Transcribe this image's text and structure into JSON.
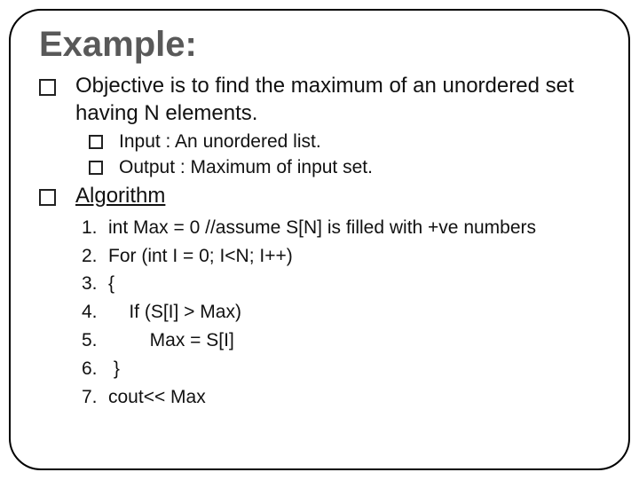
{
  "title": "Example:",
  "bullets": [
    {
      "text": "Objective is to find the maximum of an unordered set having N elements.",
      "sub": [
        {
          "text": "Input : An unordered list."
        },
        {
          "text": "Output : Maximum of input set."
        }
      ]
    },
    {
      "text": "Algorithm",
      "underline": true,
      "steps": [
        {
          "n": "1.",
          "t": "int Max = 0 //assume S[N] is filled with +ve numbers"
        },
        {
          "n": "2.",
          "t": "For (int I = 0; I<N; I++)"
        },
        {
          "n": "3.",
          "t": "{"
        },
        {
          "n": "4.",
          "t": "    If (S[I] > Max)"
        },
        {
          "n": "5.",
          "t": "        Max = S[I]"
        },
        {
          "n": "6.",
          "t": " }"
        },
        {
          "n": "7.",
          "t": "cout<< Max"
        }
      ]
    }
  ]
}
